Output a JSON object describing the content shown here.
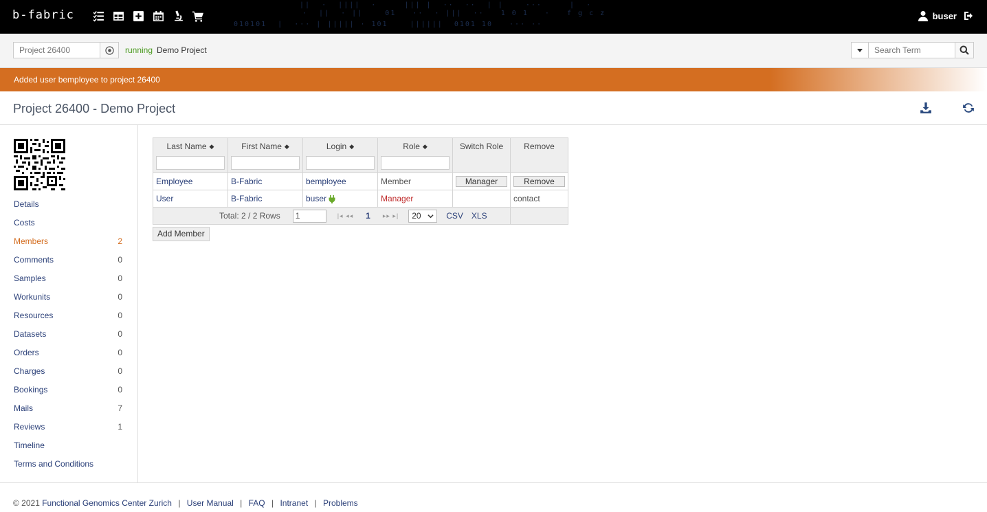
{
  "topbar": {
    "logo": "b-fabric",
    "icons": [
      "checklist-icon",
      "table-icon",
      "plus-square-icon",
      "calendar-icon",
      "microscope-icon",
      "cart-icon"
    ],
    "username": "buser"
  },
  "subbar": {
    "project_value": "Project 26400",
    "status": "running",
    "project_name": "Demo Project",
    "search_placeholder": "Search Term"
  },
  "notice": "Added user bemployee to project 26400",
  "header": {
    "title": "Project 26400 - Demo Project"
  },
  "sidebar": {
    "items": [
      {
        "label": "Details",
        "count": ""
      },
      {
        "label": "Costs",
        "count": ""
      },
      {
        "label": "Members",
        "count": "2",
        "active": true
      },
      {
        "label": "Comments",
        "count": "0"
      },
      {
        "label": "Samples",
        "count": "0"
      },
      {
        "label": "Workunits",
        "count": "0"
      },
      {
        "label": "Resources",
        "count": "0"
      },
      {
        "label": "Datasets",
        "count": "0"
      },
      {
        "label": "Orders",
        "count": "0"
      },
      {
        "label": "Charges",
        "count": "0"
      },
      {
        "label": "Bookings",
        "count": "0"
      },
      {
        "label": "Mails",
        "count": "7"
      },
      {
        "label": "Reviews",
        "count": "1"
      },
      {
        "label": "Timeline",
        "count": ""
      },
      {
        "label": "Terms and Conditions",
        "count": ""
      }
    ]
  },
  "table": {
    "columns": [
      "Last Name",
      "First Name",
      "Login",
      "Role",
      "Switch Role",
      "Remove"
    ],
    "rows": [
      {
        "last": "Employee",
        "first": "B-Fabric",
        "login": "bemployee",
        "role": "Member",
        "switch": "Manager",
        "remove": "Remove"
      },
      {
        "last": "User",
        "first": "B-Fabric",
        "login": "buser",
        "role": "Manager",
        "switch": "",
        "remove": "contact"
      }
    ],
    "footer": {
      "total": "Total: 2 / 2 Rows",
      "page_input": "1",
      "current_page": "1",
      "page_size": "20",
      "csv": "CSV",
      "xls": "XLS"
    }
  },
  "add_member_label": "Add Member",
  "footer": {
    "copyright": "© 2021",
    "links": [
      "Functional Genomics Center Zurich",
      "User Manual",
      "FAQ",
      "Intranet",
      "Problems"
    ],
    "separator": "|"
  }
}
